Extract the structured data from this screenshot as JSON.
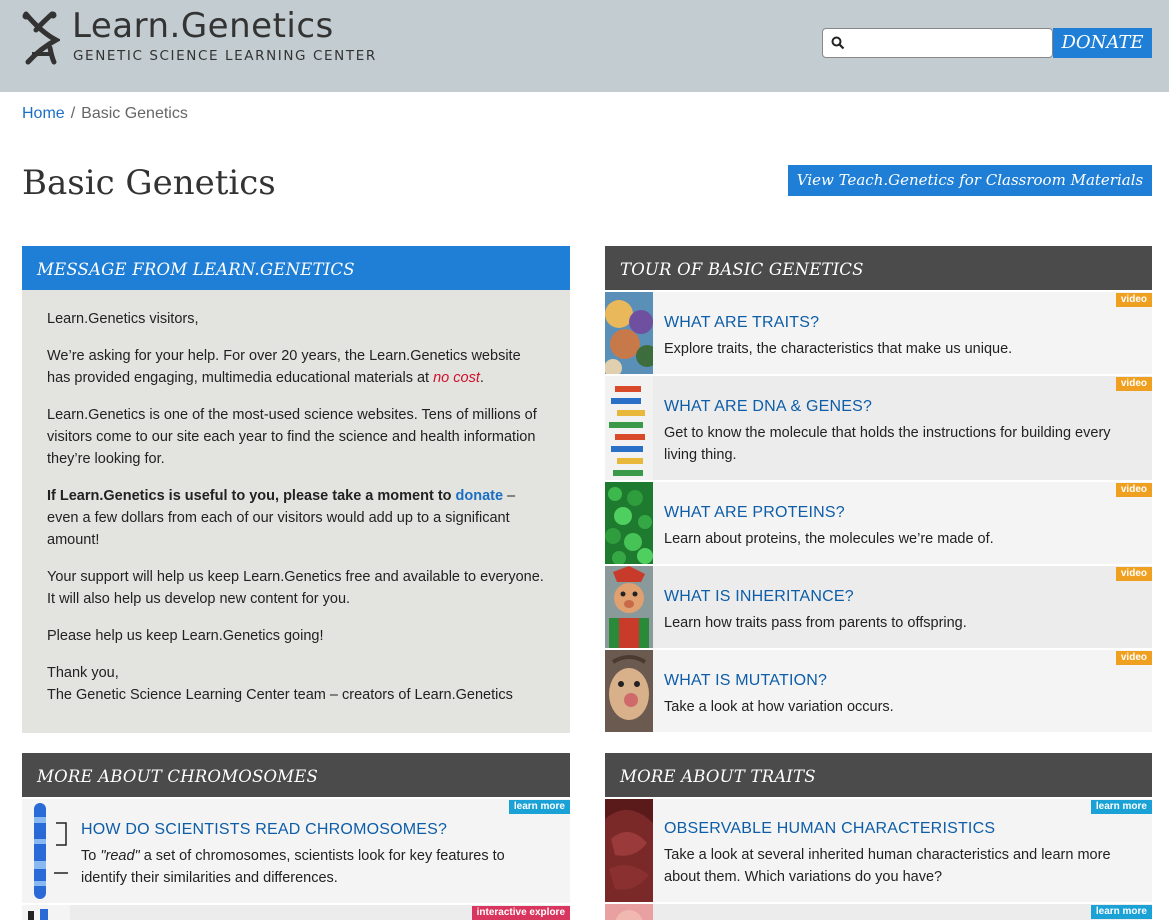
{
  "header": {
    "logo_title": "Learn.Genetics",
    "logo_subtitle": "GENETIC SCIENCE LEARNING CENTER",
    "search_placeholder": "",
    "donate_label": "DONATE"
  },
  "breadcrumb": {
    "home": "Home",
    "separator": "/",
    "current": "Basic Genetics"
  },
  "page": {
    "title": "Basic Genetics",
    "teach_button": "View Teach.Genetics for Classroom Materials"
  },
  "message": {
    "heading": "MESSAGE FROM LEARN.GENETICS",
    "greeting": "Learn.Genetics visitors,",
    "p1_text": "We’re asking for your help. For over 20 years, the Learn.Genetics website has provided engaging, multimedia educational materials at ",
    "p1_nocost": "no cost",
    "p1_end": ".",
    "p2": "Learn.Genetics is one of the most-used science websites. Tens of millions of visitors come to our site each year to find the science and health information they’re looking for.",
    "p3_bold": "If Learn.Genetics is useful to you, please take a moment to ",
    "p3_link": "donate",
    "p3_rest": " – even a few dollars from each of our visitors would add up to a significant amount!",
    "p4": "Your support will help us keep Learn.Genetics free and available to everyone. It will also help us develop new content for you.",
    "p5": "Please help us keep Learn.Genetics going!",
    "sign1": "Thank you,",
    "sign2": "The Genetic Science Learning Center team – creators of Learn.Genetics"
  },
  "tour": {
    "heading": "TOUR OF BASIC GENETICS",
    "items": [
      {
        "title": "WHAT ARE TRAITS?",
        "desc": "Explore traits, the characteristics that make us unique.",
        "badge": "video"
      },
      {
        "title": "WHAT ARE DNA & GENES?",
        "desc": "Get to know the molecule that holds the instructions for building every living thing.",
        "badge": "video"
      },
      {
        "title": "WHAT ARE PROTEINS?",
        "desc": "Learn about proteins, the molecules we’re made of.",
        "badge": "video"
      },
      {
        "title": "WHAT IS INHERITANCE?",
        "desc": "Learn how traits pass from parents to offspring.",
        "badge": "video"
      },
      {
        "title": "WHAT IS MUTATION?",
        "desc": "Take a look at how variation occurs.",
        "badge": "video"
      }
    ]
  },
  "chromosomes": {
    "heading": "MORE ABOUT CHROMOSOMES",
    "items": [
      {
        "title": "HOW DO SCIENTISTS READ CHROMOSOMES?",
        "desc_pre": "To ",
        "desc_em": "\"read\"",
        "desc_post": " a set of chromosomes, scientists look for key features to identify their similarities and differences.",
        "badge": "learn more"
      },
      {
        "badge": "interactive explore"
      }
    ]
  },
  "traits": {
    "heading": "MORE ABOUT TRAITS",
    "items": [
      {
        "title": "OBSERVABLE HUMAN CHARACTERISTICS",
        "desc": "Take a look at several inherited human characteristics and learn more about them. Which variations do you have?",
        "badge": "learn more"
      },
      {
        "badge": "learn more"
      }
    ]
  },
  "colors": {
    "header_bg": "#c3ccd0",
    "accent_blue": "#1f7fd6",
    "dark_head": "#4b4b4b",
    "link": "#0d5da8",
    "video_badge": "#f0a020",
    "learn_badge": "#1aa1d6",
    "interactive_badge": "#d8365e"
  }
}
